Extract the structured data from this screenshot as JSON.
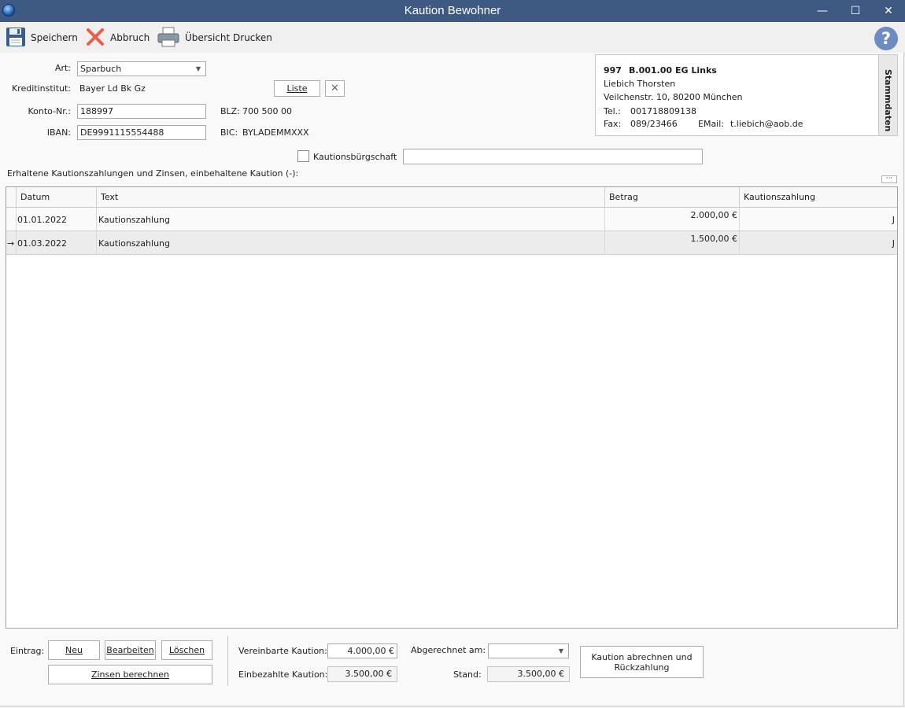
{
  "window": {
    "title": "Kaution Bewohner",
    "minimize": "—",
    "maximize": "☐",
    "close": "✕"
  },
  "toolbar": {
    "save_label": "Speichern",
    "cancel_label": "Abbruch",
    "print_label": "Übersicht Drucken",
    "help": "?"
  },
  "form": {
    "art_label": "Art:",
    "art_value": "Sparbuch",
    "kreditinstitut_label": "Kreditinstitut:",
    "kreditinstitut_value": "Bayer Ld Bk Gz",
    "liste_label": "Liste",
    "konto_label": "Konto-Nr.:",
    "konto_value": "188997",
    "blz_label": "BLZ:",
    "blz_value": "700 500 00",
    "iban_label": "IBAN:",
    "iban_value": "DE9991115554488",
    "bic_label": "BIC:",
    "bic_value": "BYLADEMMXXX",
    "buergschaft_label": "Kautionsbürgschaft",
    "buergschaft_checked": false,
    "buergschaft_text": ""
  },
  "info": {
    "number": "997",
    "unit": "B.001.00",
    "location": "EG Links",
    "name": "Liebich Thorsten",
    "address": "Veilchenstr. 10, 80200 München",
    "tel_label": "Tel.:",
    "tel_value": "001718809138",
    "fax_label": "Fax:",
    "fax_value": "089/23466",
    "email_label": "EMail:",
    "email_value": "t.liebich@aob.de",
    "tab_label": "Stammdaten"
  },
  "grid": {
    "caption": "Erhaltene Kautionszahlungen und Zinsen, einbehaltene Kaution (-):",
    "more": "···",
    "columns": [
      "Datum",
      "Text",
      "Betrag",
      "Kautionszahlung"
    ],
    "rows": [
      {
        "indicator": "",
        "datum": "01.01.2022",
        "text": "Kautionszahlung",
        "betrag": "2.000,00 €",
        "kautionszahlung": "J"
      },
      {
        "indicator": "→",
        "datum": "01.03.2022",
        "text": "Kautionszahlung",
        "betrag": "1.500,00 €",
        "kautionszahlung": "J"
      }
    ]
  },
  "bottom": {
    "eintrag_label": "Eintrag:",
    "neu_label": "Neu",
    "bearbeiten_label": "Bearbeiten",
    "loeschen_label": "Löschen",
    "zinsen_label": "Zinsen berechnen",
    "vereinbarte_label": "Vereinbarte Kaution:",
    "vereinbarte_value": "4.000,00 €",
    "einbezahlte_label": "Einbezahlte Kaution:",
    "einbezahlte_value": "3.500,00 €",
    "abgerechnet_label": "Abgerechnet am:",
    "abgerechnet_value": "",
    "stand_label": "Stand:",
    "stand_value": "3.500,00 €",
    "abrechnen_label": "Kaution abrechnen und Rückzahlung"
  }
}
